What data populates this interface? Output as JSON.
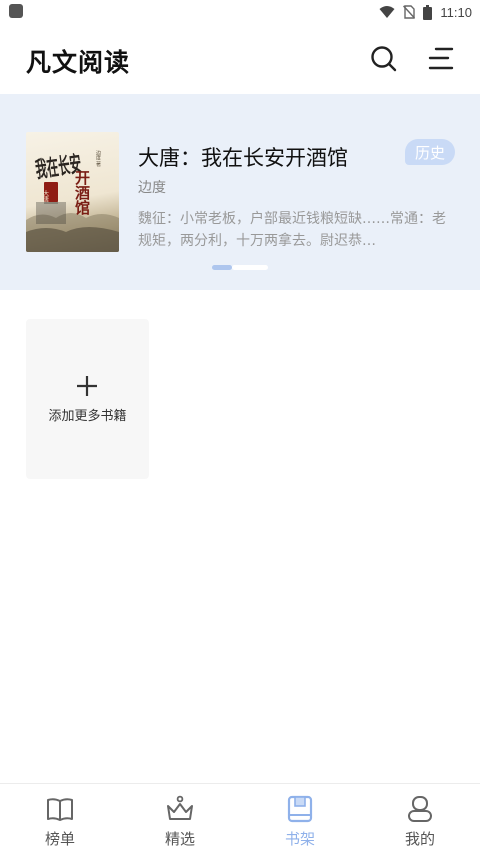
{
  "status_bar": {
    "time": "11:10",
    "icons": [
      "wifi-icon",
      "no-sim-icon",
      "battery-icon"
    ]
  },
  "header": {
    "title": "凡文阅读",
    "search_icon": "search-icon",
    "menu_icon": "menu-icon"
  },
  "history": {
    "book_title": "大唐：我在长安开酒馆",
    "tag": "历史",
    "author": "边度",
    "description": "魏征：小常老板，户部最近钱粮短缺……常通：老规矩，两分利，十万两拿去。尉迟恭…",
    "cover_text": [
      "我在长安",
      "开酒馆",
      "大唐"
    ],
    "cover_author": "边度 著",
    "active_page_index": 0,
    "page_count": 2
  },
  "shelf": {
    "add_label": "添加更多书籍",
    "add_icon": "plus-icon"
  },
  "bottom_nav": {
    "items": [
      {
        "label": "榜单",
        "icon": "book-open-icon"
      },
      {
        "label": "精选",
        "icon": "crown-icon"
      },
      {
        "label": "书架",
        "icon": "bookshelf-icon"
      },
      {
        "label": "我的",
        "icon": "user-icon"
      }
    ],
    "active_index": 2
  },
  "colors": {
    "accent": "#8fb1ea",
    "history_bg": "#eaf0f9",
    "tag_bg": "#c9daf6"
  }
}
